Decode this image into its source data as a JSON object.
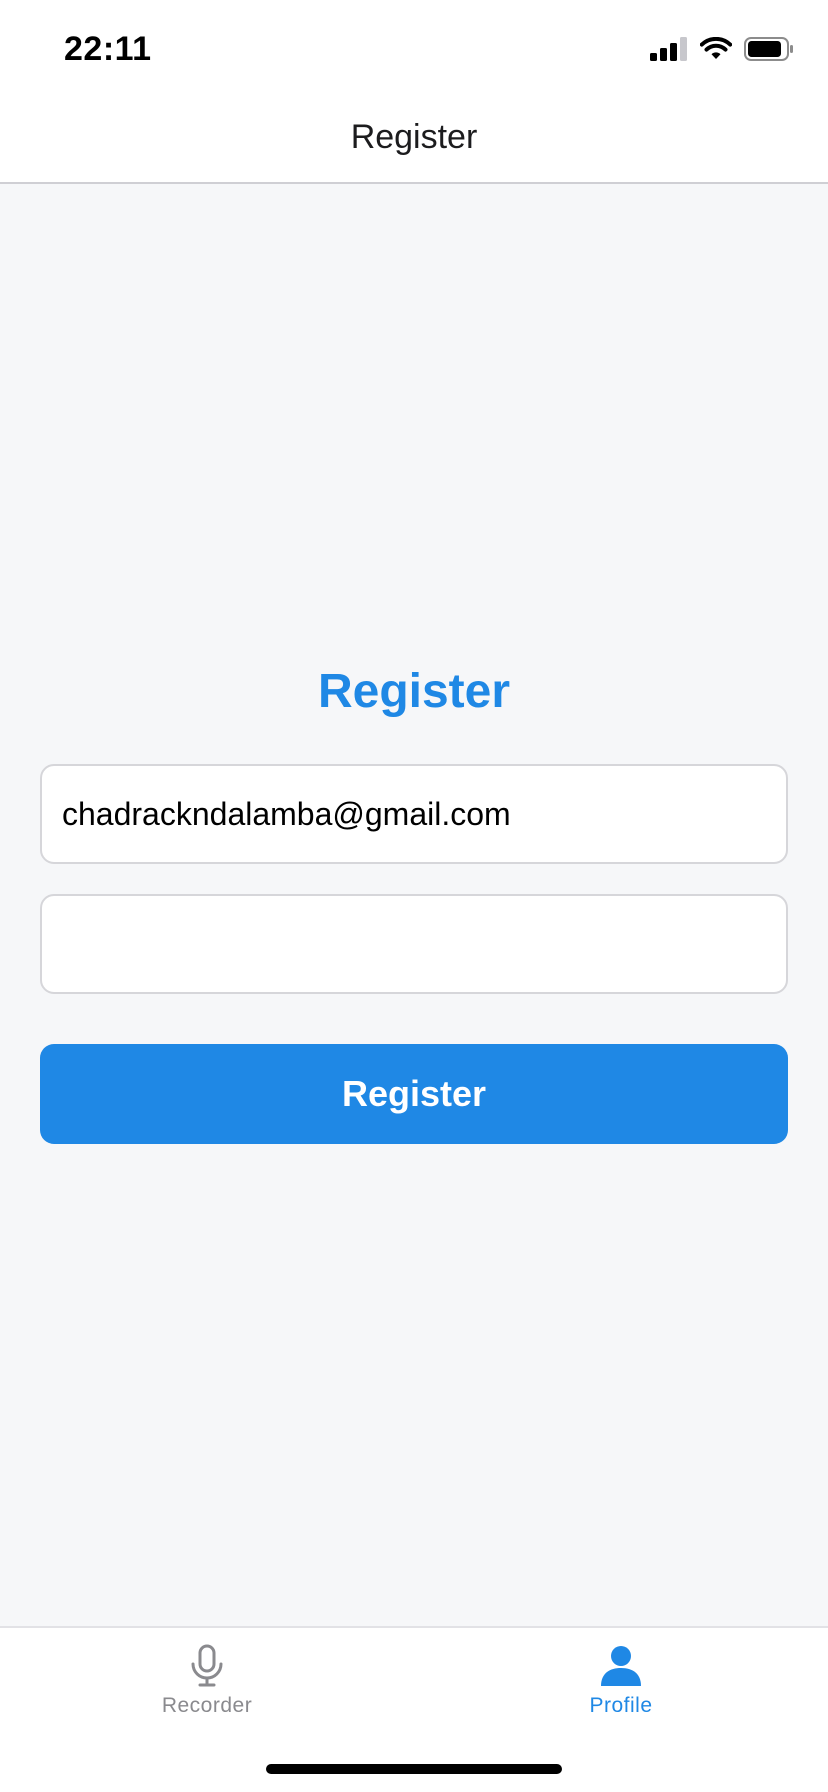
{
  "status_bar": {
    "time": "22:11"
  },
  "nav": {
    "title": "Register"
  },
  "form": {
    "heading": "Register",
    "email_value": "chadrackndalamba@gmail.com",
    "password_value": "",
    "submit_label": "Register"
  },
  "tabbar": {
    "tabs": [
      {
        "label": "Recorder",
        "icon": "microphone-icon",
        "active": false
      },
      {
        "label": "Profile",
        "icon": "person-icon",
        "active": true
      }
    ]
  },
  "colors": {
    "accent": "#1f88e5",
    "inactive": "#8a8a8e",
    "background": "#f6f7f9"
  }
}
